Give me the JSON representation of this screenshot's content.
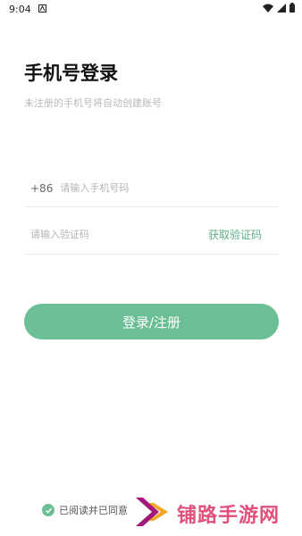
{
  "status_bar": {
    "time": "9:04",
    "left_icons": [
      "notification-a-icon"
    ],
    "right_icons": [
      "wifi-icon",
      "cell-signal-icon",
      "battery-icon"
    ]
  },
  "header": {
    "title": "手机号登录",
    "subtitle": "未注册的手机号将自动创建账号"
  },
  "phone_field": {
    "country_code": "+86",
    "placeholder": "请输入手机号码",
    "value": ""
  },
  "code_field": {
    "placeholder": "请输入验证码",
    "value": "",
    "get_code_label": "获取验证码"
  },
  "login_button": {
    "label": "登录/注册"
  },
  "agreement": {
    "text": "已阅读并已同意",
    "checked": true
  },
  "watermark": {
    "text": "铺路手游网"
  },
  "colors": {
    "accent": "#6bbf94",
    "link": "#5fae86",
    "watermark": "#e0507a"
  }
}
